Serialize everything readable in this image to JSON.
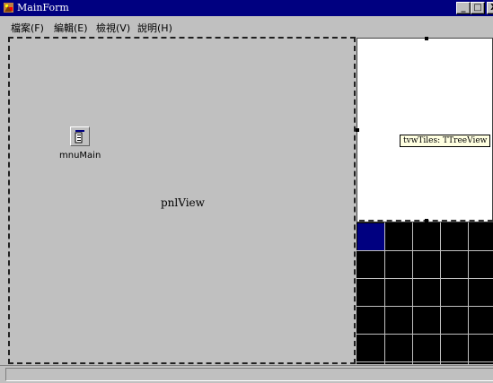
{
  "window": {
    "title": "MainForm",
    "minimize_glyph": "_",
    "maximize_glyph": "□",
    "close_glyph": "X"
  },
  "menu": {
    "items": [
      {
        "label": "檔案(F)"
      },
      {
        "label": "編輯(E)"
      },
      {
        "label": "檢視(V)"
      },
      {
        "label": "說明(H)"
      }
    ]
  },
  "left_panel": {
    "component_label": "mnuMain",
    "component_icon": "main-menu-component-icon",
    "panel_label": "pnlView"
  },
  "tree_view": {
    "hint": "tvwTiles: TTreeView"
  },
  "grid": {
    "columns": 5,
    "rows": 5,
    "selected_cell": [
      0,
      0
    ],
    "selected_color": "#000080",
    "background_color": "#000000"
  },
  "colors": {
    "titlebar": "#000080",
    "face": "#c0c0c0"
  }
}
